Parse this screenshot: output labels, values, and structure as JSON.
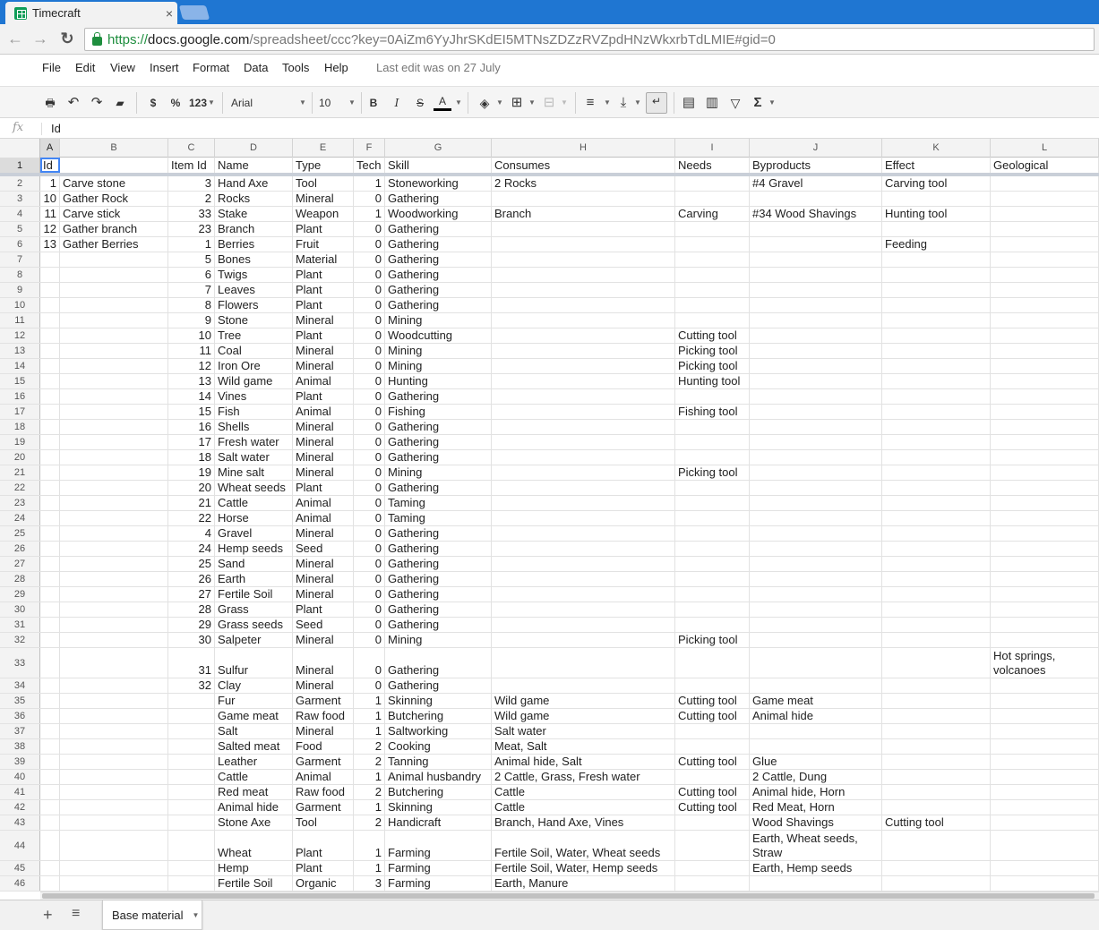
{
  "browser": {
    "tab_title": "Timecraft",
    "url_scheme": "https://",
    "url_host": "docs.google.com",
    "url_path": "/spreadsheet/ccc?key=0AiZm6YyJhrSKdEI5MTNsZDZzRVZpdHNzWkxrbTdLMIE#gid=0"
  },
  "menu": {
    "items": [
      "File",
      "Edit",
      "View",
      "Insert",
      "Format",
      "Data",
      "Tools",
      "Help"
    ],
    "last_edit": "Last edit was on 27 July"
  },
  "toolbar": {
    "currency": "$",
    "percent": "%",
    "number_format": "123",
    "font": "Arial",
    "font_size": "10",
    "bold": "B",
    "italic": "I",
    "strike": "S",
    "text_color": "A",
    "sum": "Σ"
  },
  "formula": {
    "fx": "fx",
    "value": "Id"
  },
  "columns": [
    "A",
    "B",
    "C",
    "D",
    "E",
    "F",
    "G",
    "H",
    "I",
    "J",
    "K",
    "L"
  ],
  "rows": [
    [
      "Id",
      "",
      "Item Id",
      "Name",
      "Type",
      "Tech",
      "Skill",
      "Consumes",
      "Needs",
      "Byproducts",
      "Effect",
      "Geological"
    ],
    [
      "1",
      "Carve stone",
      "3",
      "Hand Axe",
      "Tool",
      "1",
      "Stoneworking",
      "2 Rocks",
      "",
      "#4 Gravel",
      "Carving tool",
      ""
    ],
    [
      "10",
      "Gather Rock",
      "2",
      "Rocks",
      "Mineral",
      "0",
      "Gathering",
      "",
      "",
      "",
      "",
      ""
    ],
    [
      "11",
      "Carve stick",
      "33",
      "Stake",
      "Weapon",
      "1",
      "Woodworking",
      "Branch",
      "Carving",
      "#34 Wood Shavings",
      "Hunting tool",
      ""
    ],
    [
      "12",
      "Gather branch",
      "23",
      "Branch",
      "Plant",
      "0",
      "Gathering",
      "",
      "",
      "",
      "",
      ""
    ],
    [
      "13",
      "Gather Berries",
      "1",
      "Berries",
      "Fruit",
      "0",
      "Gathering",
      "",
      "",
      "",
      "Feeding",
      ""
    ],
    [
      "",
      "",
      "5",
      "Bones",
      "Material",
      "0",
      "Gathering",
      "",
      "",
      "",
      "",
      ""
    ],
    [
      "",
      "",
      "6",
      "Twigs",
      "Plant",
      "0",
      "Gathering",
      "",
      "",
      "",
      "",
      ""
    ],
    [
      "",
      "",
      "7",
      "Leaves",
      "Plant",
      "0",
      "Gathering",
      "",
      "",
      "",
      "",
      ""
    ],
    [
      "",
      "",
      "8",
      "Flowers",
      "Plant",
      "0",
      "Gathering",
      "",
      "",
      "",
      "",
      ""
    ],
    [
      "",
      "",
      "9",
      "Stone",
      "Mineral",
      "0",
      "Mining",
      "",
      "",
      "",
      "",
      ""
    ],
    [
      "",
      "",
      "10",
      "Tree",
      "Plant",
      "0",
      "Woodcutting",
      "",
      "Cutting tool",
      "",
      "",
      ""
    ],
    [
      "",
      "",
      "11",
      "Coal",
      "Mineral",
      "0",
      "Mining",
      "",
      "Picking tool",
      "",
      "",
      ""
    ],
    [
      "",
      "",
      "12",
      "Iron Ore",
      "Mineral",
      "0",
      "Mining",
      "",
      "Picking tool",
      "",
      "",
      ""
    ],
    [
      "",
      "",
      "13",
      "Wild game",
      "Animal",
      "0",
      "Hunting",
      "",
      "Hunting tool",
      "",
      "",
      ""
    ],
    [
      "",
      "",
      "14",
      "Vines",
      "Plant",
      "0",
      "Gathering",
      "",
      "",
      "",
      "",
      ""
    ],
    [
      "",
      "",
      "15",
      "Fish",
      "Animal",
      "0",
      "Fishing",
      "",
      "Fishing tool",
      "",
      "",
      ""
    ],
    [
      "",
      "",
      "16",
      "Shells",
      "Mineral",
      "0",
      "Gathering",
      "",
      "",
      "",
      "",
      ""
    ],
    [
      "",
      "",
      "17",
      "Fresh water",
      "Mineral",
      "0",
      "Gathering",
      "",
      "",
      "",
      "",
      ""
    ],
    [
      "",
      "",
      "18",
      "Salt water",
      "Mineral",
      "0",
      "Gathering",
      "",
      "",
      "",
      "",
      ""
    ],
    [
      "",
      "",
      "19",
      "Mine salt",
      "Mineral",
      "0",
      "Mining",
      "",
      "Picking tool",
      "",
      "",
      ""
    ],
    [
      "",
      "",
      "20",
      "Wheat seeds",
      "Plant",
      "0",
      "Gathering",
      "",
      "",
      "",
      "",
      ""
    ],
    [
      "",
      "",
      "21",
      "Cattle",
      "Animal",
      "0",
      "Taming",
      "",
      "",
      "",
      "",
      ""
    ],
    [
      "",
      "",
      "22",
      "Horse",
      "Animal",
      "0",
      "Taming",
      "",
      "",
      "",
      "",
      ""
    ],
    [
      "",
      "",
      "4",
      "Gravel",
      "Mineral",
      "0",
      "Gathering",
      "",
      "",
      "",
      "",
      ""
    ],
    [
      "",
      "",
      "24",
      "Hemp seeds",
      "Seed",
      "0",
      "Gathering",
      "",
      "",
      "",
      "",
      ""
    ],
    [
      "",
      "",
      "25",
      "Sand",
      "Mineral",
      "0",
      "Gathering",
      "",
      "",
      "",
      "",
      ""
    ],
    [
      "",
      "",
      "26",
      "Earth",
      "Mineral",
      "0",
      "Gathering",
      "",
      "",
      "",
      "",
      ""
    ],
    [
      "",
      "",
      "27",
      "Fertile Soil",
      "Mineral",
      "0",
      "Gathering",
      "",
      "",
      "",
      "",
      ""
    ],
    [
      "",
      "",
      "28",
      "Grass",
      "Plant",
      "0",
      "Gathering",
      "",
      "",
      "",
      "",
      ""
    ],
    [
      "",
      "",
      "29",
      "Grass seeds",
      "Seed",
      "0",
      "Gathering",
      "",
      "",
      "",
      "",
      ""
    ],
    [
      "",
      "",
      "30",
      "Salpeter",
      "Mineral",
      "0",
      "Mining",
      "",
      "Picking tool",
      "",
      "",
      ""
    ],
    [
      "",
      "",
      "31",
      "Sulfur",
      "Mineral",
      "0",
      "Gathering",
      "",
      "",
      "",
      "",
      "Hot springs, volcanoes"
    ],
    [
      "",
      "",
      "32",
      "Clay",
      "Mineral",
      "0",
      "Gathering",
      "",
      "",
      "",
      "",
      ""
    ],
    [
      "",
      "",
      "",
      "Fur",
      "Garment",
      "1",
      "Skinning",
      "Wild game",
      "Cutting tool",
      "Game meat",
      "",
      ""
    ],
    [
      "",
      "",
      "",
      "Game meat",
      "Raw food",
      "1",
      "Butchering",
      "Wild game",
      "Cutting tool",
      "Animal hide",
      "",
      ""
    ],
    [
      "",
      "",
      "",
      "Salt",
      "Mineral",
      "1",
      "Saltworking",
      "Salt water",
      "",
      "",
      "",
      ""
    ],
    [
      "",
      "",
      "",
      "Salted meat",
      "Food",
      "2",
      "Cooking",
      "Meat, Salt",
      "",
      "",
      "",
      ""
    ],
    [
      "",
      "",
      "",
      "Leather",
      "Garment",
      "2",
      "Tanning",
      "Animal hide, Salt",
      "Cutting tool",
      "Glue",
      "",
      ""
    ],
    [
      "",
      "",
      "",
      "Cattle",
      "Animal",
      "1",
      "Animal husbandry",
      "2 Cattle, Grass, Fresh water",
      "",
      "2 Cattle, Dung",
      "",
      ""
    ],
    [
      "",
      "",
      "",
      "Red meat",
      "Raw food",
      "2",
      "Butchering",
      "Cattle",
      "Cutting tool",
      "Animal hide, Horn",
      "",
      ""
    ],
    [
      "",
      "",
      "",
      "Animal hide",
      "Garment",
      "1",
      "Skinning",
      "Cattle",
      "Cutting tool",
      "Red Meat, Horn",
      "",
      ""
    ],
    [
      "",
      "",
      "",
      "Stone Axe",
      "Tool",
      "2",
      "Handicraft",
      "Branch, Hand Axe, Vines",
      "",
      "Wood Shavings",
      "Cutting tool",
      ""
    ],
    [
      "",
      "",
      "",
      "Wheat",
      "Plant",
      "1",
      "Farming",
      "Fertile Soil, Water, Wheat seeds",
      "",
      "Earth, Wheat seeds, Straw",
      "",
      ""
    ],
    [
      "",
      "",
      "",
      "Hemp",
      "Plant",
      "1",
      "Farming",
      "Fertile Soil, Water, Hemp seeds",
      "",
      "Earth, Hemp seeds",
      "",
      ""
    ],
    [
      "",
      "",
      "",
      "Fertile Soil",
      "Organic",
      "3",
      "Farming",
      "Earth, Manure",
      "",
      "",
      "",
      ""
    ]
  ],
  "sheets": {
    "active": "Base material"
  }
}
